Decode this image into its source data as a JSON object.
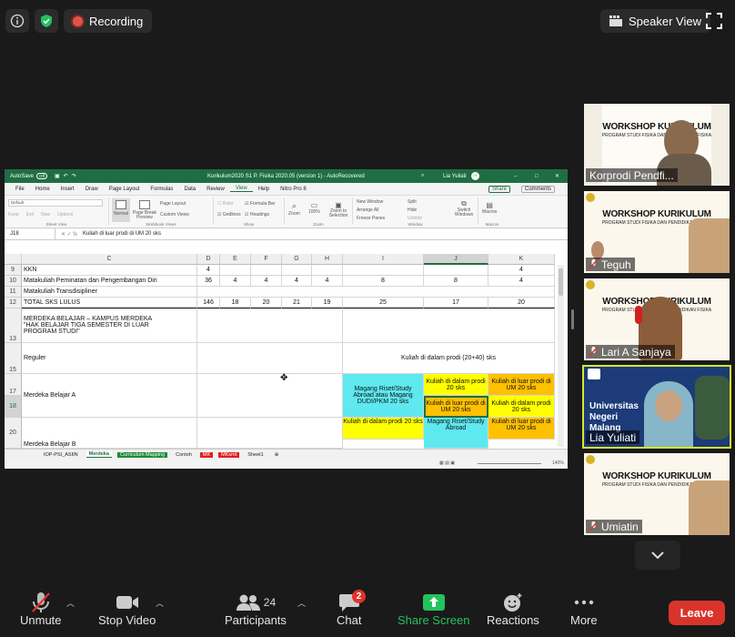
{
  "topbar": {
    "recording": "Recording",
    "speaker_view": "Speaker View"
  },
  "excel": {
    "quick_access": "AutoSave",
    "autosave_state": "Off",
    "title": "Kurikulum2020 S1 P. Fisika 2020.05 (version 1) - AutoRecovered",
    "user": "Lia Yuliati",
    "user_initials": "LY",
    "menu": [
      "File",
      "Home",
      "Insert",
      "Draw",
      "Page Layout",
      "Formulas",
      "Data",
      "Review",
      "View",
      "Help",
      "Nitro Pro 8"
    ],
    "active_menu": "View",
    "share_label": "Share",
    "comments_label": "Comments",
    "ribbon": {
      "groups": [
        "Sheet View",
        "Workbook Views",
        "Show",
        "Zoom",
        "Window",
        "Macros"
      ],
      "sheet_view": {
        "default": "Default",
        "keep": "Keep",
        "exit": "Exit",
        "new": "New",
        "options": "Options"
      },
      "workbook_views": [
        "Normal",
        "Page Break Preview",
        "Page Layout",
        "Custom Views"
      ],
      "show": [
        "Ruler",
        "Formula Bar",
        "Gridlines",
        "Headings"
      ],
      "zoom": [
        "Zoom",
        "100%",
        "Zoom to Selection"
      ],
      "window": [
        "New Window",
        "Arrange All",
        "Freeze Panes",
        "Split",
        "Hide",
        "Unhide",
        "Switch Windows"
      ],
      "macros": "Macros"
    },
    "name_box": "J18",
    "formula": "Kuliah di luar prodi di UM 20 sks",
    "columns": [
      "C",
      "D",
      "E",
      "F",
      "G",
      "H",
      "I",
      "J",
      "K"
    ],
    "rows": {
      "r9": {
        "n": "9",
        "c": "KKN",
        "d": "4",
        "k": "4"
      },
      "r10": {
        "n": "10",
        "c": "Matakuliah Peminatan dan Pengembangan Diri",
        "d": "36",
        "e": "4",
        "f": "4",
        "g": "4",
        "h": "4",
        "i": "8",
        "j": "8",
        "k": "4"
      },
      "r11": {
        "n": "11",
        "c": "Matakuliah Transdisipliner"
      },
      "r12": {
        "n": "12",
        "c": "TOTAL SKS LULUS",
        "d": "146",
        "e": "18",
        "f": "20",
        "g": "21",
        "h": "19",
        "i": "25",
        "j": "17",
        "k": "20"
      },
      "r13": {
        "n": "13",
        "c1": "MERDEKA BELAJAR – KAMPUS MERDEKA",
        "c2": "\"HAK BELAJAR TIGA SEMESTER DI LUAR",
        "c3": "PROGRAM STUDI\""
      },
      "r15": {
        "n": "15",
        "c": "Reguler",
        "ik": "Kuliah di dalam prodi (20+40) sks"
      },
      "r17": {
        "n": "17",
        "c": "Merdeka Belajar A",
        "i": "Magang Riset/Study Abroad atau Magang DUDI/PKM 20 sks",
        "j": "Kuliah di dalam prodi 20 sks",
        "k": "Kuliah di luar prodi di UM 20 sks"
      },
      "r18": {
        "n": "18",
        "j": "Kuliah di luar prodi di UM 20 sks",
        "k": "Kuliah di dalam prodi 20 sks"
      },
      "r20": {
        "n": "20",
        "c": "Merdeka Belajar B",
        "i": "Kuliah di dalam prodi 20 sks",
        "j": "Magang Riset/Study Abroad",
        "k": "Kuliah di luar prodi di UM 20 sks"
      }
    },
    "sheets": [
      "IOP-PSI_ASIIN",
      "Merdeka",
      "Curriculum Mapping",
      "Contoh",
      "MK",
      "MKsmt",
      "Sheet1"
    ],
    "active_sheet": "Merdeka",
    "zoom": "140%"
  },
  "gallery": [
    {
      "name": "Korprodi Pendfi...",
      "banner": "WORKSHOP KURIKULUM",
      "sub": "PROGRAM STUDI FISIKA DAN PENDIDIKAN FISIKA"
    },
    {
      "name": "Teguh",
      "banner": "WORKSHOP KURIKULUM",
      "sub": "PROGRAM STUDI FISIKA DAN PENDIDIKAN FISIKA"
    },
    {
      "name": "Lari A Sanjaya",
      "banner": "WORKSHOP KURIKULUM",
      "sub": "PROGRAM STUDI FISIKA DAN PENDIDIKAN FISIKA"
    },
    {
      "name": "Lia Yuliati",
      "banner": "Universitas Negeri Malang",
      "sub": ""
    },
    {
      "name": "Umiatin",
      "banner": "WORKSHOP KURIKULUM",
      "sub": "PROGRAM STUDI FISIKA DAN PENDIDIKAN FISIKA"
    }
  ],
  "toolbar": {
    "unmute": "Unmute",
    "stop_video": "Stop Video",
    "participants": "Participants",
    "participants_count": "24",
    "chat": "Chat",
    "chat_badge": "2",
    "share_screen": "Share Screen",
    "reactions": "Reactions",
    "more": "More",
    "leave": "Leave"
  },
  "colors": {
    "share_green": "#23c25e",
    "leave_red": "#d9342b",
    "excel_green": "#1f6e43",
    "highlight_yellow": "#ffff00",
    "highlight_orange": "#ffc000",
    "highlight_cyan": "#5ee8f0"
  }
}
